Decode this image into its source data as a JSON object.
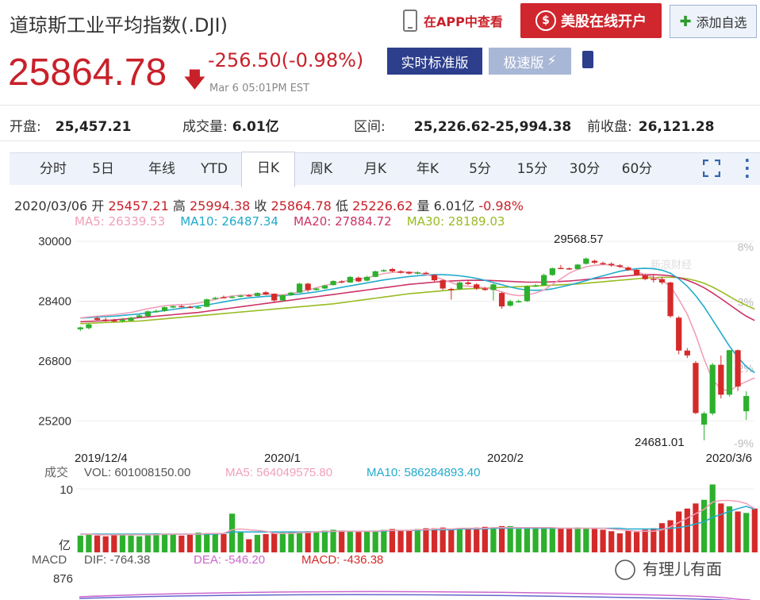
{
  "header": {
    "title": "道琼斯工业平均指数(.DJI)",
    "app_link": "在APP中查看",
    "open_account": "美股在线开户",
    "add_watch": "添加自选",
    "price": "25864.78",
    "change": "-256.50(-0.98%)",
    "timestamp": "Mar 6 05:01PM EST",
    "realtime": "实时标准版",
    "fast": "极速版"
  },
  "stats": [
    {
      "label": "开盘:",
      "value": "25,457.21"
    },
    {
      "label": "成交量:",
      "value": "6.01亿"
    },
    {
      "label": "区间:",
      "value": "25,226.62-25,994.38"
    },
    {
      "label": "前收盘:",
      "value": "26,121.28"
    }
  ],
  "tabs": [
    "分时",
    "5日",
    "年线",
    "YTD",
    "日K",
    "周K",
    "月K",
    "年K",
    "5分",
    "15分",
    "30分",
    "60分"
  ],
  "active_tab": "日K",
  "ohlc": {
    "date": "2020/03/06",
    "open_label": "开",
    "open": "25457.21",
    "high_label": "高",
    "high": "25994.38",
    "close_label": "收",
    "close": "25864.78",
    "low_label": "低",
    "low": "25226.62",
    "vol_label": "量",
    "vol": "6.01亿",
    "pct": "-0.98%"
  },
  "ma": {
    "ma5": "MA5: 26339.53",
    "ma10": "MA10: 26487.34",
    "ma20": "MA20: 27884.72",
    "ma30": "MA30: 28189.03"
  },
  "colors": {
    "up": "#2db02d",
    "down": "#d42a2a",
    "ma5": "#f0a0b8",
    "ma10": "#22aacc",
    "ma20": "#cc3366",
    "ma30": "#99bb22",
    "accent": "#2c3e8c"
  },
  "chart_data": {
    "type": "candlestick",
    "y_ticks": [
      "30000",
      "28400",
      "26800",
      "25200"
    ],
    "ylim": [
      24400,
      30300
    ],
    "right_ticks": [
      "8%",
      "3%",
      "-2%",
      "-9%"
    ],
    "x_ticks": [
      "2019/12/4",
      "2020/1",
      "2020/2",
      "2020/3/6"
    ],
    "annotations": {
      "high": "29568.57",
      "low": "24681.01"
    },
    "watermark": "新浪财经",
    "candles": [
      {
        "o": 27650,
        "c": 27700,
        "h": 27720,
        "l": 27600
      },
      {
        "o": 27680,
        "c": 27780,
        "h": 27800,
        "l": 27650
      },
      {
        "o": 27950,
        "c": 27900,
        "h": 27990,
        "l": 27880
      },
      {
        "o": 27910,
        "c": 27880,
        "h": 27960,
        "l": 27850
      },
      {
        "o": 27890,
        "c": 27870,
        "h": 27930,
        "l": 27840
      },
      {
        "o": 27870,
        "c": 27900,
        "h": 27950,
        "l": 27830
      },
      {
        "o": 27880,
        "c": 27960,
        "h": 27980,
        "l": 27860
      },
      {
        "o": 27970,
        "c": 28020,
        "h": 28060,
        "l": 27950
      },
      {
        "o": 28000,
        "c": 28130,
        "h": 28150,
        "l": 27990
      },
      {
        "o": 28120,
        "c": 28140,
        "h": 28180,
        "l": 28090
      },
      {
        "o": 28140,
        "c": 28240,
        "h": 28260,
        "l": 28120
      },
      {
        "o": 28230,
        "c": 28270,
        "h": 28290,
        "l": 28210
      },
      {
        "o": 28270,
        "c": 28260,
        "h": 28300,
        "l": 28230
      },
      {
        "o": 28250,
        "c": 28240,
        "h": 28280,
        "l": 28210
      },
      {
        "o": 28230,
        "c": 28240,
        "h": 28280,
        "l": 28200
      },
      {
        "o": 28250,
        "c": 28450,
        "h": 28470,
        "l": 28240
      },
      {
        "o": 28460,
        "c": 28490,
        "h": 28520,
        "l": 28440
      },
      {
        "o": 28510,
        "c": 28500,
        "h": 28550,
        "l": 28480
      },
      {
        "o": 28500,
        "c": 28520,
        "h": 28540,
        "l": 28470
      },
      {
        "o": 28530,
        "c": 28550,
        "h": 28570,
        "l": 28500
      },
      {
        "o": 28560,
        "c": 28540,
        "h": 28590,
        "l": 28520
      },
      {
        "o": 28540,
        "c": 28620,
        "h": 28640,
        "l": 28530
      },
      {
        "o": 28640,
        "c": 28580,
        "h": 28670,
        "l": 28560
      },
      {
        "o": 28600,
        "c": 28420,
        "h": 28610,
        "l": 28380
      },
      {
        "o": 28420,
        "c": 28560,
        "h": 28580,
        "l": 28400
      },
      {
        "o": 28560,
        "c": 28630,
        "h": 28650,
        "l": 28540
      },
      {
        "o": 28630,
        "c": 28870,
        "h": 28890,
        "l": 28620
      },
      {
        "o": 28870,
        "c": 28700,
        "h": 28890,
        "l": 28650
      },
      {
        "o": 28700,
        "c": 28740,
        "h": 28760,
        "l": 28680
      },
      {
        "o": 28740,
        "c": 28820,
        "h": 28840,
        "l": 28720
      },
      {
        "o": 28830,
        "c": 28940,
        "h": 28960,
        "l": 28820
      },
      {
        "o": 28930,
        "c": 28900,
        "h": 28960,
        "l": 28880
      },
      {
        "o": 28900,
        "c": 29050,
        "h": 29070,
        "l": 28890
      },
      {
        "o": 29030,
        "c": 28930,
        "h": 29060,
        "l": 28910
      },
      {
        "o": 28950,
        "c": 29050,
        "h": 29080,
        "l": 28930
      },
      {
        "o": 29050,
        "c": 29200,
        "h": 29220,
        "l": 29040
      },
      {
        "o": 29200,
        "c": 29230,
        "h": 29260,
        "l": 29180
      },
      {
        "o": 29260,
        "c": 29200,
        "h": 29290,
        "l": 29170
      },
      {
        "o": 29200,
        "c": 29160,
        "h": 29230,
        "l": 29140
      },
      {
        "o": 29180,
        "c": 29140,
        "h": 29200,
        "l": 29120
      },
      {
        "o": 29140,
        "c": 29170,
        "h": 29200,
        "l": 29110
      },
      {
        "o": 29160,
        "c": 29150,
        "h": 29190,
        "l": 29130
      },
      {
        "o": 29100,
        "c": 28960,
        "h": 29120,
        "l": 28920
      },
      {
        "o": 28960,
        "c": 28740,
        "h": 28980,
        "l": 28700
      },
      {
        "o": 28730,
        "c": 28720,
        "h": 28760,
        "l": 28440
      },
      {
        "o": 28720,
        "c": 28900,
        "h": 28920,
        "l": 28700
      },
      {
        "o": 28900,
        "c": 28860,
        "h": 28950,
        "l": 28830
      },
      {
        "o": 28850,
        "c": 28740,
        "h": 28880,
        "l": 28700
      },
      {
        "o": 28740,
        "c": 28700,
        "h": 28780,
        "l": 28680
      },
      {
        "o": 28700,
        "c": 28850,
        "h": 28880,
        "l": 28420
      },
      {
        "o": 28620,
        "c": 28260,
        "h": 28650,
        "l": 28200
      },
      {
        "o": 28280,
        "c": 28400,
        "h": 28440,
        "l": 28250
      },
      {
        "o": 28400,
        "c": 28400,
        "h": 28440,
        "l": 28360
      },
      {
        "o": 28400,
        "c": 28800,
        "h": 28820,
        "l": 28380
      },
      {
        "o": 28800,
        "c": 28820,
        "h": 28860,
        "l": 28780
      },
      {
        "o": 28820,
        "c": 29100,
        "h": 29140,
        "l": 28810
      },
      {
        "o": 29100,
        "c": 29280,
        "h": 29300,
        "l": 29080
      },
      {
        "o": 29290,
        "c": 29270,
        "h": 29370,
        "l": 29260
      },
      {
        "o": 29280,
        "c": 29260,
        "h": 29300,
        "l": 29240
      },
      {
        "o": 29260,
        "c": 29380,
        "h": 29400,
        "l": 29250
      },
      {
        "o": 29400,
        "c": 29540,
        "h": 29569,
        "l": 29380
      },
      {
        "o": 29480,
        "c": 29430,
        "h": 29510,
        "l": 29400
      },
      {
        "o": 29420,
        "c": 29400,
        "h": 29460,
        "l": 29370
      },
      {
        "o": 29400,
        "c": 29360,
        "h": 29440,
        "l": 29320
      },
      {
        "o": 29360,
        "c": 29320,
        "h": 29390,
        "l": 29290
      },
      {
        "o": 29300,
        "c": 29230,
        "h": 29330,
        "l": 29210
      },
      {
        "o": 29240,
        "c": 29100,
        "h": 29260,
        "l": 29080
      },
      {
        "o": 29100,
        "c": 28990,
        "h": 29140,
        "l": 28960
      },
      {
        "o": 29000,
        "c": 28990,
        "h": 29110,
        "l": 28900
      },
      {
        "o": 28990,
        "c": 28900,
        "h": 29050,
        "l": 28850
      },
      {
        "o": 28900,
        "c": 28000,
        "h": 28920,
        "l": 27960
      },
      {
        "o": 27960,
        "c": 27080,
        "h": 28000,
        "l": 26980
      },
      {
        "o": 27080,
        "c": 26950,
        "h": 27150,
        "l": 26880
      },
      {
        "o": 26750,
        "c": 25410,
        "h": 26800,
        "l": 25380
      },
      {
        "o": 25100,
        "c": 25400,
        "h": 25450,
        "l": 24681
      },
      {
        "o": 25400,
        "c": 26700,
        "h": 26750,
        "l": 25350
      },
      {
        "o": 26700,
        "c": 25900,
        "h": 26950,
        "l": 25800
      },
      {
        "o": 25900,
        "c": 27090,
        "h": 27100,
        "l": 25850
      },
      {
        "o": 27090,
        "c": 26120,
        "h": 27110,
        "l": 26000
      },
      {
        "o": 25457,
        "c": 25865,
        "h": 25994,
        "l": 25227
      }
    ],
    "ma5": [
      27950,
      27980,
      28000,
      28020,
      28040,
      28070,
      28100,
      28150,
      28200,
      28240,
      28280,
      28300,
      28310,
      28320,
      28350,
      28400,
      28450,
      28500,
      28540,
      28560,
      28570,
      28580,
      28590,
      28580,
      28570,
      28600,
      28650,
      28700,
      28760,
      28820,
      28870,
      28920,
      28960,
      28990,
      29030,
      29080,
      29140,
      29170,
      29180,
      29180,
      29160,
      29120,
      29050,
      28980,
      28900,
      28820,
      28800,
      28780,
      28760,
      28720,
      28650,
      28580,
      28550,
      28560,
      28620,
      28700,
      28850,
      29000,
      29150,
      29250,
      29320,
      29360,
      29380,
      29370,
      29330,
      29260,
      29190,
      29110,
      29040,
      28960,
      28800,
      28450,
      28050,
      27500,
      26850,
      26300,
      26050,
      26000,
      26150,
      26250,
      26350
    ],
    "ma10": [
      27950,
      27960,
      27980,
      27990,
      28000,
      28020,
      28040,
      28060,
      28090,
      28120,
      28150,
      28180,
      28210,
      28240,
      28270,
      28300,
      28340,
      28380,
      28420,
      28460,
      28490,
      28510,
      28530,
      28540,
      28550,
      28570,
      28590,
      28620,
      28650,
      28690,
      28730,
      28770,
      28810,
      28850,
      28890,
      28930,
      28970,
      29000,
      29030,
      29060,
      29080,
      29100,
      29110,
      29110,
      29100,
      29080,
      29050,
      29010,
      28960,
      28900,
      28840,
      28780,
      28730,
      28700,
      28690,
      28700,
      28730,
      28780,
      28830,
      28890,
      28950,
      29020,
      29080,
      29140,
      29200,
      29240,
      29270,
      29280,
      29270,
      29230,
      29150,
      29000,
      28800,
      28550,
      28250,
      27900,
      27550,
      27200,
      26900,
      26650,
      26487
    ],
    "ma20": [
      27850,
      27860,
      27870,
      27880,
      27900,
      27920,
      27940,
      27960,
      27980,
      28000,
      28020,
      28040,
      28060,
      28080,
      28100,
      28130,
      28160,
      28190,
      28220,
      28250,
      28280,
      28310,
      28340,
      28370,
      28400,
      28430,
      28460,
      28490,
      28520,
      28550,
      28580,
      28610,
      28640,
      28670,
      28700,
      28730,
      28760,
      28790,
      28820,
      28850,
      28870,
      28890,
      28910,
      28930,
      28940,
      28950,
      28960,
      28960,
      28960,
      28950,
      28940,
      28930,
      28920,
      28910,
      28910,
      28910,
      28920,
      28930,
      28940,
      28960,
      28980,
      29000,
      29020,
      29040,
      29060,
      29080,
      29100,
      29110,
      29110,
      29100,
      29080,
      29030,
      28960,
      28870,
      28760,
      28620,
      28470,
      28310,
      28150,
      28000,
      27885
    ],
    "ma30": [
      27800,
      27810,
      27820,
      27830,
      27840,
      27850,
      27860,
      27870,
      27890,
      27910,
      27930,
      27950,
      27970,
      27990,
      28010,
      28030,
      28050,
      28070,
      28090,
      28110,
      28130,
      28150,
      28170,
      28190,
      28210,
      28230,
      28250,
      28270,
      28290,
      28310,
      28330,
      28360,
      28390,
      28420,
      28450,
      28480,
      28510,
      28540,
      28570,
      28600,
      28620,
      28640,
      28660,
      28680,
      28700,
      28720,
      28730,
      28740,
      28750,
      28760,
      28770,
      28780,
      28790,
      28800,
      28810,
      28820,
      28830,
      28840,
      28850,
      28860,
      28880,
      28900,
      28920,
      28940,
      28960,
      28980,
      29000,
      29020,
      29030,
      29040,
      29040,
      29030,
      29000,
      28950,
      28880,
      28780,
      28660,
      28530,
      28400,
      28290,
      28189
    ]
  },
  "volume": {
    "label": "成交",
    "vol": "VOL: 601008150.00",
    "ma5": "MA5: 564049575.80",
    "ma10": "MA10: 586284893.40",
    "y_top": "10",
    "y_unit": "亿",
    "max": 10,
    "values": [
      2.3,
      2.4,
      2.3,
      2.2,
      2.4,
      2.5,
      2.3,
      2.2,
      2.4,
      2.6,
      2.5,
      2.5,
      2.3,
      2.4,
      2.7,
      2.6,
      2.6,
      2.5,
      5.3,
      2.8,
      1.8,
      2.4,
      2.5,
      2.6,
      2.7,
      2.8,
      2.8,
      2.9,
      2.9,
      3.0,
      3.1,
      3.0,
      2.9,
      2.8,
      2.9,
      3.0,
      3.1,
      3.2,
      3.0,
      3.1,
      3.2,
      3.3,
      3.3,
      3.4,
      3.1,
      3.2,
      3.3,
      3.4,
      3.5,
      3.4,
      3.6,
      3.6,
      3.2,
      3.3,
      3.4,
      3.3,
      3.4,
      3.3,
      3.3,
      3.4,
      3.3,
      3.2,
      3.1,
      2.9,
      2.6,
      3.0,
      2.8,
      3.1,
      3.3,
      4.0,
      4.4,
      5.6,
      6.0,
      6.7,
      7.2,
      9.3,
      6.7,
      6.3,
      5.6,
      5.4,
      6.0
    ],
    "ma5_line": [
      2.5,
      2.5,
      2.4,
      2.4,
      2.4,
      2.4,
      2.4,
      2.4,
      2.4,
      2.4,
      2.5,
      2.5,
      2.5,
      2.5,
      2.5,
      2.6,
      2.6,
      2.6,
      3.1,
      3.2,
      3.1,
      3.0,
      2.9,
      2.6,
      2.6,
      2.6,
      2.7,
      2.7,
      2.8,
      2.9,
      2.9,
      2.9,
      2.9,
      2.9,
      2.9,
      2.9,
      3.0,
      3.0,
      3.0,
      3.0,
      3.1,
      3.1,
      3.2,
      3.2,
      3.2,
      3.3,
      3.3,
      3.3,
      3.3,
      3.4,
      3.4,
      3.4,
      3.4,
      3.4,
      3.4,
      3.4,
      3.4,
      3.3,
      3.3,
      3.3,
      3.3,
      3.3,
      3.3,
      3.2,
      3.1,
      3.0,
      2.9,
      2.9,
      2.9,
      3.1,
      3.5,
      4.1,
      4.7,
      5.3,
      5.9,
      6.9,
      7.1,
      7.1,
      7.0,
      6.7,
      6.0
    ],
    "ma10_line": [
      2.5,
      2.5,
      2.5,
      2.5,
      2.5,
      2.5,
      2.5,
      2.5,
      2.5,
      2.5,
      2.5,
      2.5,
      2.5,
      2.5,
      2.5,
      2.5,
      2.5,
      2.6,
      2.8,
      2.8,
      2.8,
      2.8,
      2.8,
      2.8,
      2.8,
      2.8,
      2.8,
      2.8,
      2.8,
      2.8,
      2.9,
      2.9,
      2.9,
      2.9,
      2.9,
      2.9,
      2.9,
      3.0,
      3.0,
      3.0,
      3.0,
      3.1,
      3.1,
      3.1,
      3.1,
      3.2,
      3.2,
      3.2,
      3.2,
      3.3,
      3.3,
      3.3,
      3.3,
      3.3,
      3.3,
      3.3,
      3.3,
      3.3,
      3.3,
      3.3,
      3.3,
      3.3,
      3.3,
      3.3,
      3.3,
      3.2,
      3.2,
      3.2,
      3.2,
      3.2,
      3.3,
      3.4,
      3.6,
      3.9,
      4.2,
      4.8,
      5.2,
      5.6,
      6.0,
      6.3,
      5.9
    ]
  },
  "macd": {
    "label": "MACD",
    "dif": "DIF: -764.38",
    "dea": "DEA: -546.20",
    "macd": "MACD: -436.38",
    "y_top": "876"
  },
  "brand": {
    "name": "有理儿有面"
  }
}
